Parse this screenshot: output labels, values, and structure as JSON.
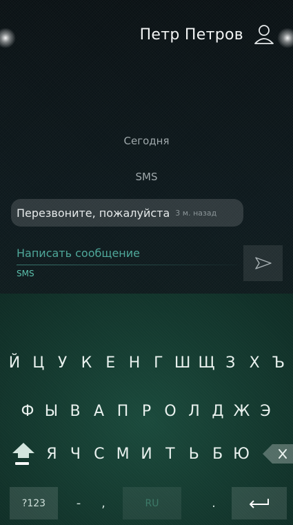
{
  "header": {
    "contact_name": "Петр Петров",
    "contact_icon": "person-icon"
  },
  "conversation": {
    "date_separator": "Сегодня",
    "channel_label": "SMS",
    "messages": [
      {
        "text": "Перезвоните, пожалуйста",
        "time": "3 м. назад"
      }
    ]
  },
  "compose": {
    "placeholder": "Написать сообщение",
    "channel": "SMS",
    "send_icon": "send-icon"
  },
  "keyboard": {
    "row1": [
      "Й",
      "Ц",
      "У",
      "К",
      "Е",
      "Н",
      "Г",
      "Ш",
      "Щ",
      "З",
      "Х",
      "Ъ"
    ],
    "row2": [
      "Ф",
      "Ы",
      "В",
      "А",
      "П",
      "Р",
      "О",
      "Л",
      "Д",
      "Ж",
      "Э"
    ],
    "row3": [
      "Я",
      "Ч",
      "С",
      "М",
      "И",
      "Т",
      "Ь",
      "Б",
      "Ю"
    ],
    "shift_icon": "shift-icon",
    "backspace_icon": "backspace-icon",
    "symbols_label": "?123",
    "dash_label": "-",
    "comma_label": ",",
    "space_label": "RU",
    "period_label": ".",
    "enter_icon": "enter-icon"
  },
  "colors": {
    "accent": "#5cc1ad",
    "keyboard_bg": "#1b4a3c",
    "screen_bg": "#0e1a1e"
  }
}
